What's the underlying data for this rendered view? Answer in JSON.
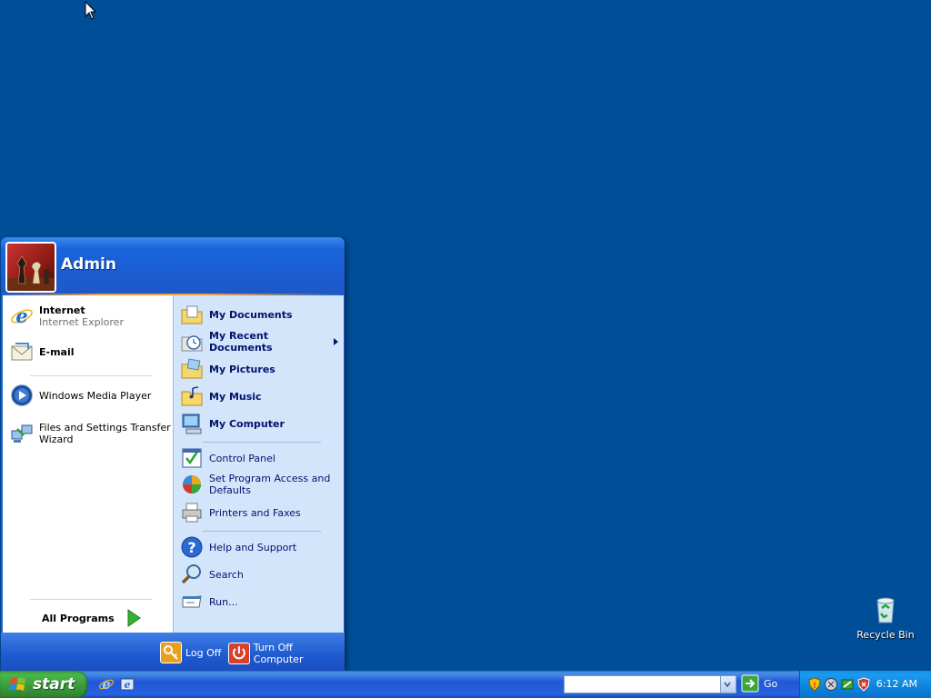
{
  "desktop": {
    "icons": [
      {
        "label": "Recycle Bin",
        "icon": "recycle-bin-icon"
      }
    ]
  },
  "start_menu": {
    "user": {
      "name": "Admin",
      "avatar": "chess-avatar"
    },
    "pinned": [
      {
        "title": "Internet",
        "subtitle": "Internet Explorer",
        "icon": "internet-explorer-icon"
      },
      {
        "title": "E-mail",
        "icon": "email-icon"
      }
    ],
    "recent": [
      {
        "title": "Windows Media Player",
        "icon": "media-player-icon"
      },
      {
        "title": "Files and Settings Transfer",
        "title2": "Wizard",
        "icon": "transfer-wizard-icon"
      }
    ],
    "all_programs": "All Programs",
    "places": [
      {
        "label": "My Documents",
        "icon": "folder-documents-icon"
      },
      {
        "label": "My Recent Documents",
        "icon": "recent-documents-icon",
        "has_submenu": true
      },
      {
        "label": "My Pictures",
        "icon": "folder-pictures-icon"
      },
      {
        "label": "My Music",
        "icon": "folder-music-icon"
      },
      {
        "label": "My Computer",
        "icon": "computer-icon"
      }
    ],
    "settings": [
      {
        "label": "Control Panel",
        "icon": "control-panel-icon"
      },
      {
        "label": "Set Program Access and",
        "label2": "Defaults",
        "icon": "program-access-icon"
      },
      {
        "label": "Printers and Faxes",
        "icon": "printer-icon"
      }
    ],
    "tools": [
      {
        "label": "Help and Support",
        "icon": "help-icon"
      },
      {
        "label": "Search",
        "icon": "search-icon"
      },
      {
        "label": "Run...",
        "icon": "run-icon"
      }
    ],
    "footer": {
      "log_off": "Log Off",
      "turn_off": "Turn Off Computer"
    }
  },
  "taskbar": {
    "start_label": "start",
    "quick_launch": [
      "internet-explorer-icon",
      "show-desktop-icon"
    ],
    "search": {
      "value": "",
      "go_label": "Go"
    },
    "tray_icons": [
      "security-shield-icon",
      "network-icon",
      "update-icon",
      "antivirus-icon"
    ],
    "clock": "6:12 AM"
  },
  "colors": {
    "desktop": "#004e98",
    "taskbar": "#245edb",
    "start_button": "#3c9e3c",
    "right_pane": "#d3e5fa"
  }
}
